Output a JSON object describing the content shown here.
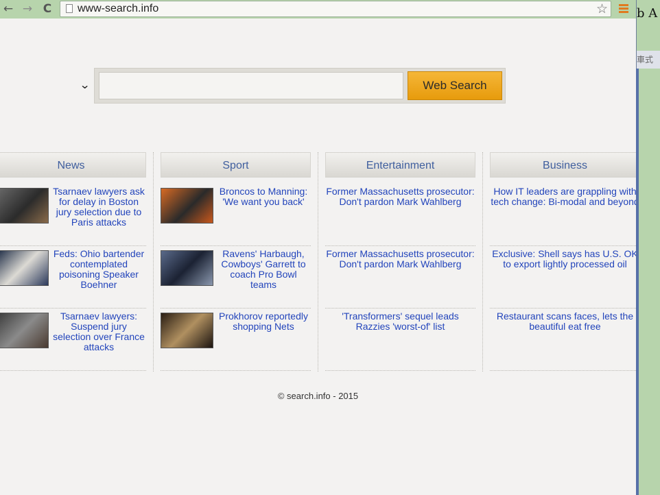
{
  "browser": {
    "back_icon": "back-arrow-icon",
    "forward_icon": "forward-arrow-icon",
    "reload_icon": "reload-icon",
    "address": "www-search.info",
    "back_glyph": "←",
    "forward_glyph": "→",
    "reload_glyph": "C",
    "star_glyph": "☆"
  },
  "search": {
    "dropdown_glyph": "⌄",
    "input_value": "",
    "button_label": "Web Search"
  },
  "columns": [
    {
      "title": "News",
      "items": [
        {
          "text": "Tsarnaev lawyers ask for delay in Boston jury selection due to Paris attacks",
          "has_thumb": true
        },
        {
          "text": "Feds: Ohio bartender contemplated poisoning Speaker Boehner",
          "has_thumb": true
        },
        {
          "text": "Tsarnaev lawyers: Suspend jury selection over France attacks",
          "has_thumb": true
        }
      ]
    },
    {
      "title": "Sport",
      "items": [
        {
          "text": "Broncos to Manning: 'We want you back'",
          "has_thumb": true
        },
        {
          "text": "Ravens' Harbaugh, Cowboys' Garrett to coach Pro Bowl teams",
          "has_thumb": true
        },
        {
          "text": "Prokhorov reportedly shopping Nets",
          "has_thumb": true
        }
      ]
    },
    {
      "title": "Entertainment",
      "items": [
        {
          "text": "Former Massachusetts prosecutor: Don't pardon Mark Wahlberg",
          "has_thumb": false
        },
        {
          "text": "Former Massachusetts prosecutor: Don't pardon Mark Wahlberg",
          "has_thumb": false
        },
        {
          "text": "'Transformers' sequel leads Razzies 'worst-of' list",
          "has_thumb": false
        }
      ]
    },
    {
      "title": "Business",
      "items": [
        {
          "text": "How IT leaders are grappling with tech change: Bi-modal and beyond",
          "has_thumb": false
        },
        {
          "text": "Exclusive: Shell says has U.S. OK to export lightly processed oil",
          "has_thumb": false
        },
        {
          "text": "Restaurant scans faces, lets the beautiful eat free",
          "has_thumb": false
        }
      ]
    }
  ],
  "footer": "© search.info - 2015",
  "right_window": {
    "glyph": "b A",
    "strip_text": "車式"
  },
  "colors": {
    "link": "#2244bb",
    "header_text": "#3f5e9e",
    "button": "#f0a81f"
  }
}
